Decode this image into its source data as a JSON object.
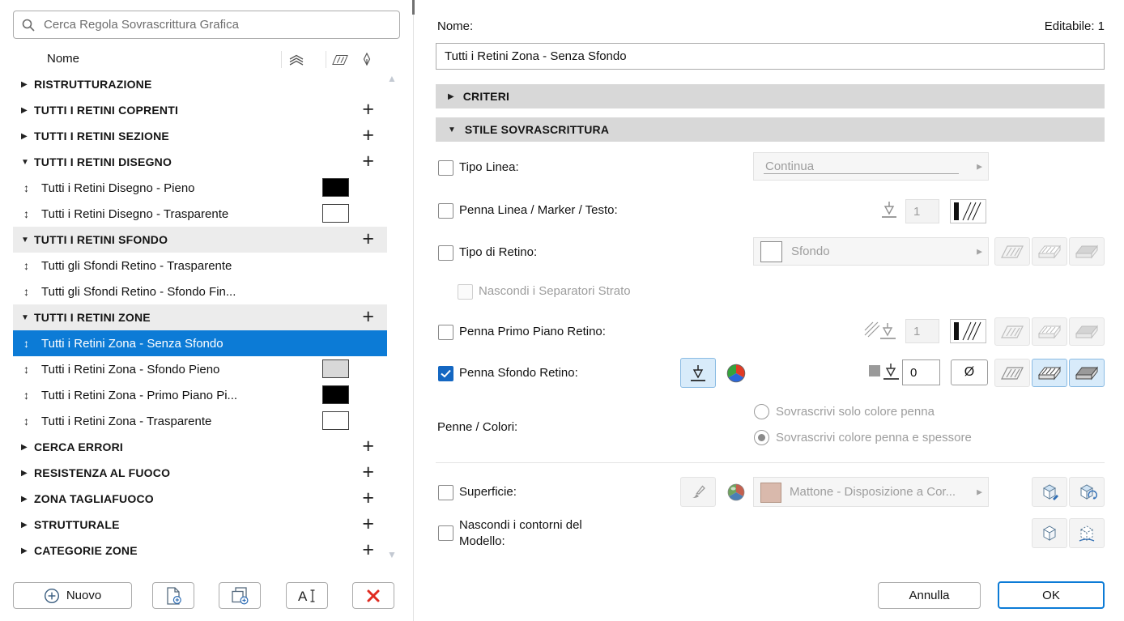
{
  "colors": {
    "accent": "#0c7bd6",
    "selection_bg": "#0c7bd6",
    "checkbox_blue": "#1467c2",
    "section_header_bg": "#d8d8d8",
    "delete_red": "#e02b20",
    "surface_swatch": "#d9b9ac"
  },
  "left_panel": {
    "search_placeholder": "Cerca Regola Sovrascrittura Grafica",
    "header": {
      "name": "Nome"
    },
    "header_icons": [
      "layers-icon",
      "fill-hatch-icon",
      "pen-icon"
    ],
    "rows": [
      {
        "type": "group",
        "label": "RISTRUTTURAZIONE",
        "expanded": false,
        "plus": false
      },
      {
        "type": "group",
        "label": "TUTTI I RETINI COPRENTI",
        "expanded": false,
        "plus": true
      },
      {
        "type": "group",
        "label": "TUTTI I RETINI SEZIONE",
        "expanded": false,
        "plus": true
      },
      {
        "type": "group",
        "label": "TUTTI I RETINI DISEGNO",
        "expanded": true,
        "plus": true
      },
      {
        "type": "item",
        "label": "Tutti i Retini Disegno - Pieno",
        "swatch": "#000000"
      },
      {
        "type": "item",
        "label": "Tutti i Retini Disegno - Trasparente",
        "swatch": "#ffffff"
      },
      {
        "type": "group",
        "label": "TUTTI I RETINI SFONDO",
        "expanded": true,
        "plus": true,
        "shaded": true
      },
      {
        "type": "item",
        "label": "Tutti gli Sfondi Retino - Trasparente"
      },
      {
        "type": "item",
        "label": "Tutti gli Sfondi Retino - Sfondo Fin..."
      },
      {
        "type": "group",
        "label": "TUTTI I RETINI ZONE",
        "expanded": true,
        "plus": true,
        "shaded": true
      },
      {
        "type": "item",
        "label": "Tutti i Retini Zona - Senza Sfondo",
        "selected": true
      },
      {
        "type": "item",
        "label": "Tutti i Retini Zona - Sfondo Pieno",
        "swatch": "#d8d8d8"
      },
      {
        "type": "item",
        "label": "Tutti i Retini Zona - Primo Piano Pi...",
        "swatch": "#000000"
      },
      {
        "type": "item",
        "label": "Tutti i Retini Zona - Trasparente",
        "swatch": "#ffffff"
      },
      {
        "type": "group",
        "label": "CERCA ERRORI",
        "expanded": false,
        "plus": true
      },
      {
        "type": "group",
        "label": "RESISTENZA AL FUOCO",
        "expanded": false,
        "plus": true
      },
      {
        "type": "group",
        "label": "ZONA TAGLIAFUOCO",
        "expanded": false,
        "plus": true
      },
      {
        "type": "group",
        "label": "STRUTTURALE",
        "expanded": false,
        "plus": true
      },
      {
        "type": "group",
        "label": "CATEGORIE ZONE",
        "expanded": false,
        "plus": true
      }
    ],
    "footer": {
      "new_label": "Nuovo"
    }
  },
  "right_panel": {
    "name_label": "Nome:",
    "editable_label": "Editabile: 1",
    "name_value": "Tutti i Retini Zona - Senza Sfondo",
    "section_criteria": "CRITERI",
    "section_style": "STILE SOVRASCRITTURA",
    "tipo_linea": {
      "label": "Tipo Linea:",
      "value": "Continua",
      "checked": false
    },
    "penna_linea": {
      "label": "Penna Linea / Marker / Testo:",
      "pen": "1",
      "checked": false
    },
    "tipo_retino": {
      "label": "Tipo di Retino:",
      "value": "Sfondo",
      "checked": false
    },
    "nascondi_separatori": {
      "label": "Nascondi i Separatori Strato",
      "checked": false
    },
    "penna_primo_piano": {
      "label": "Penna Primo Piano Retino:",
      "pen": "1",
      "checked": false
    },
    "penna_sfondo": {
      "label": "Penna Sfondo Retino:",
      "pen": "0",
      "diameter": "Ø",
      "checked": true
    },
    "penne_colori": {
      "label": "Penne / Colori:",
      "option_color_only": "Sovrascrivi solo colore penna",
      "option_color_weight": "Sovrascrivi colore penna e spessore",
      "selected_option": "option_color_weight"
    },
    "superficie": {
      "label": "Superficie:",
      "value": "Mattone - Disposizione a Cor...",
      "checked": false
    },
    "nascondi_contorni": {
      "label": "Nascondi i contorni del Modello:",
      "checked": false
    },
    "footer": {
      "cancel": "Annulla",
      "ok": "OK"
    }
  }
}
